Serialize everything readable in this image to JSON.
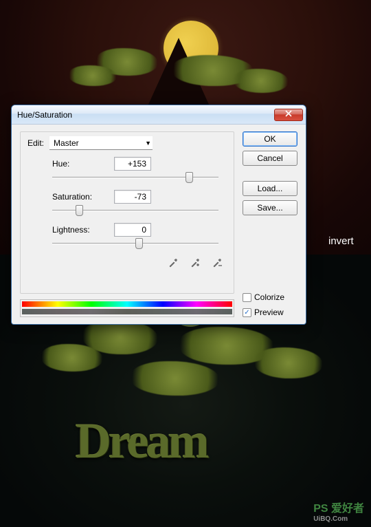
{
  "background": {
    "invert_label": "invert",
    "dream_text": "Dream",
    "watermark": {
      "main": "PS 爱好者",
      "url": "UiBQ.Com"
    }
  },
  "dialog": {
    "title": "Hue/Saturation",
    "edit_label": "Edit:",
    "edit_value": "Master",
    "sliders": {
      "hue": {
        "label": "Hue:",
        "value": "+153",
        "pos_pct": 80
      },
      "saturation": {
        "label": "Saturation:",
        "value": "-73",
        "pos_pct": 14
      },
      "lightness": {
        "label": "Lightness:",
        "value": "0",
        "pos_pct": 50
      }
    },
    "eyedroppers": [
      "eyedropper",
      "eyedropper-add",
      "eyedropper-subtract"
    ],
    "buttons": {
      "ok": "OK",
      "cancel": "Cancel",
      "load": "Load...",
      "save": "Save..."
    },
    "checkboxes": {
      "colorize": {
        "label": "Colorize",
        "checked": false
      },
      "preview": {
        "label": "Preview",
        "checked": true
      }
    }
  }
}
